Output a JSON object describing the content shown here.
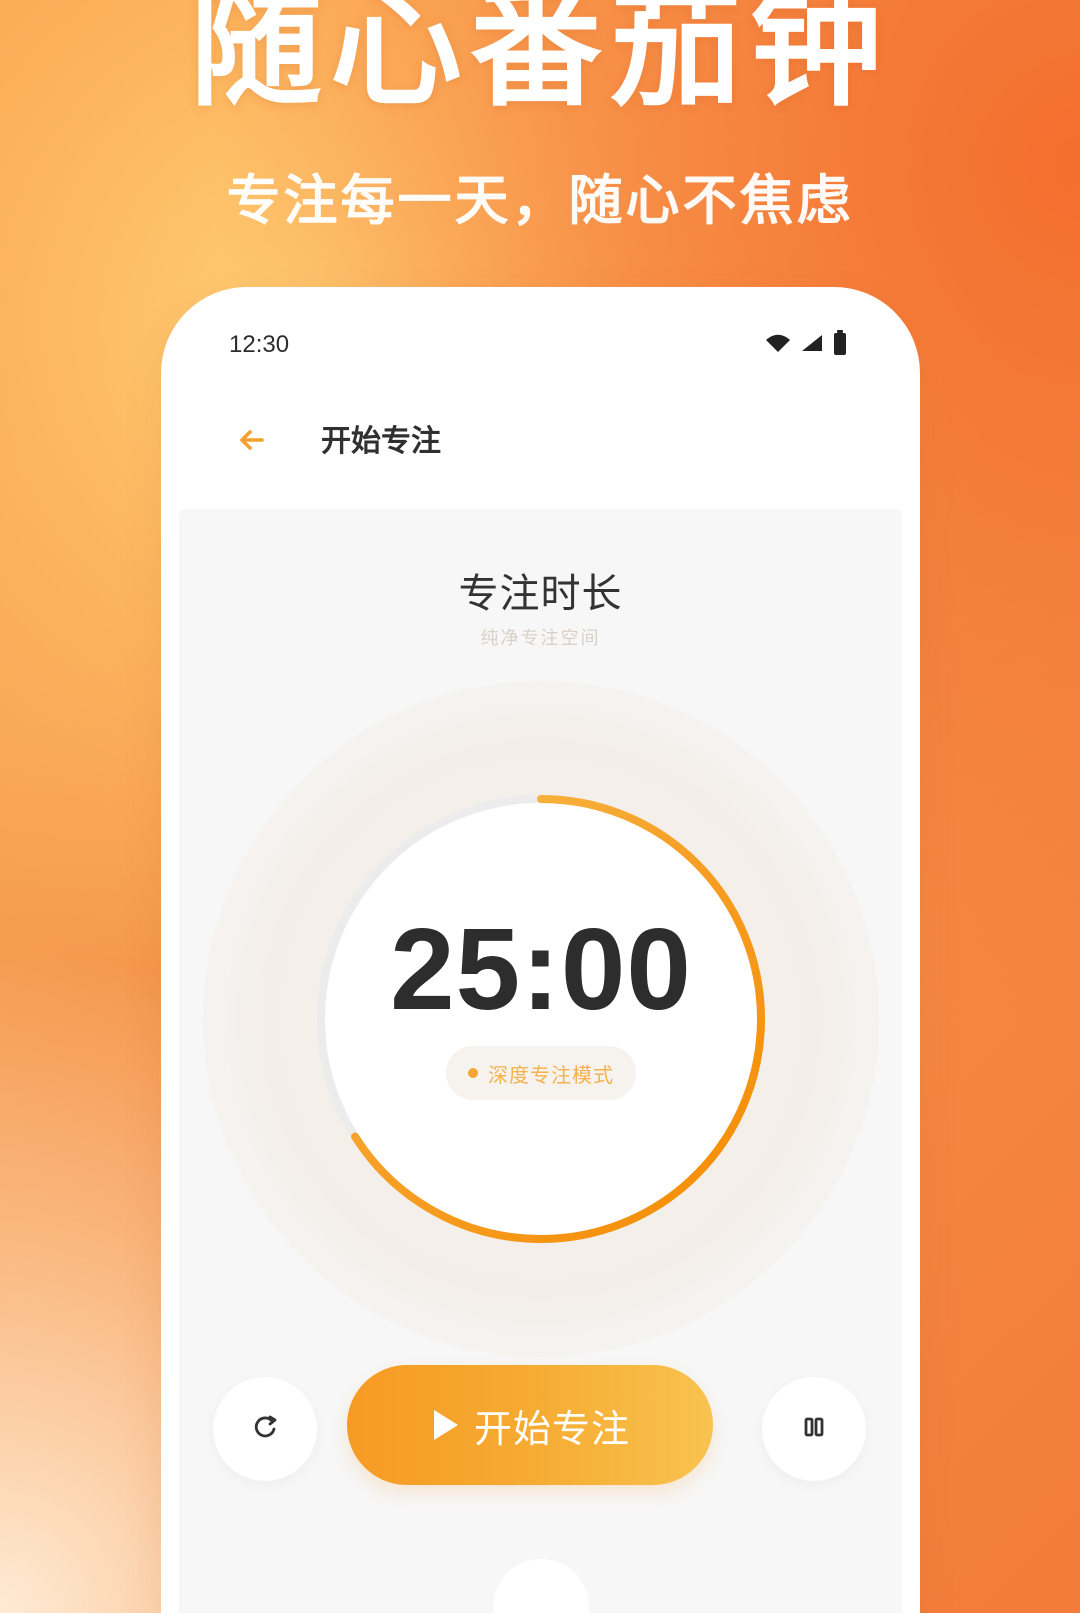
{
  "hero": {
    "title": "随心番茄钟",
    "subtitle": "专注每一天，随心不焦虑"
  },
  "status": {
    "time": "12:30",
    "icons": [
      "wifi-icon",
      "signal-icon",
      "battery-icon"
    ]
  },
  "header": {
    "back_icon": "arrow-left-icon",
    "title": "开始专注"
  },
  "main": {
    "section_title": "专注时长",
    "section_subtitle": "纯净专注空间",
    "timer": {
      "time": "25:00",
      "progress": 0.66,
      "mode_label": "深度专注模式"
    },
    "controls": {
      "reset_icon": "refresh-icon",
      "start_icon": "play-icon",
      "start_label": "开始专注",
      "pause_icon": "pause-icon"
    }
  },
  "colors": {
    "accent_orange": "#F6A129",
    "accent_light": "#F8C34F",
    "page_bg_orange": "#F48D46",
    "text_dark": "#2D2D2D",
    "muted_text": "#D9D1C7"
  }
}
